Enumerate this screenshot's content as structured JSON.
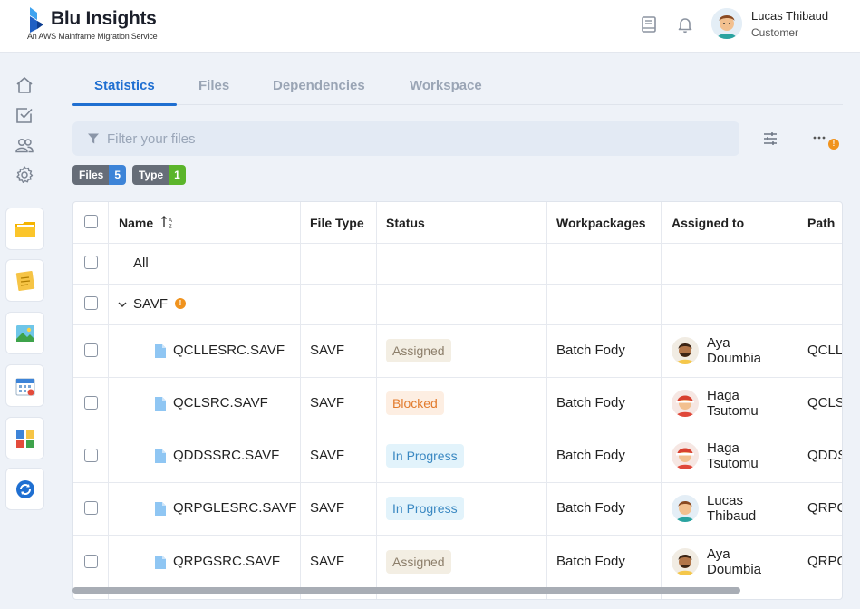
{
  "brand": {
    "title": "Blu Insights",
    "subtitle": "An AWS Mainframe Migration Service",
    "color": "#1f6fd1"
  },
  "header": {
    "icons": [
      "book-icon",
      "bell-icon"
    ],
    "user": {
      "name": "Lucas Thibaud",
      "role": "Customer"
    }
  },
  "rail": {
    "nav_icons": [
      "home-icon",
      "checklist-icon",
      "users-icon",
      "gear-icon"
    ],
    "apps": [
      "folder-app-icon",
      "notes-app-icon",
      "image-app-icon",
      "calendar-app-icon",
      "dashboard-app-icon",
      "sync-app-icon"
    ]
  },
  "tabs": [
    {
      "label": "Statistics",
      "active": true
    },
    {
      "label": "Files",
      "active": false
    },
    {
      "label": "Dependencies",
      "active": false
    },
    {
      "label": "Workspace",
      "active": false
    }
  ],
  "filter": {
    "placeholder": "Filter your files",
    "value": "",
    "alert_badge": "!"
  },
  "chips": [
    {
      "label": "Files",
      "count": "5",
      "color": "#3d84d8"
    },
    {
      "label": "Type",
      "count": "1",
      "color": "#5bb52b"
    }
  ],
  "table": {
    "columns": [
      "Name",
      "File Type",
      "Status",
      "Workpackages",
      "Assigned to",
      "Path"
    ],
    "all_label": "All",
    "group": {
      "label": "SAVF",
      "badge": "!"
    },
    "rows": [
      {
        "name": "QCLLESRC.SAVF",
        "type": "SAVF",
        "status": "Assigned",
        "status_kind": "assigned",
        "workpackage": "Batch Fody",
        "assignee_first": "Aya",
        "assignee_last": "Doumbia",
        "path": "QCLL"
      },
      {
        "name": "QCLSRC.SAVF",
        "type": "SAVF",
        "status": "Blocked",
        "status_kind": "blocked",
        "workpackage": "Batch Fody",
        "assignee_first": "Haga",
        "assignee_last": "Tsutomu",
        "path": "QCLS"
      },
      {
        "name": "QDDSSRC.SAVF",
        "type": "SAVF",
        "status": "In Progress",
        "status_kind": "progress",
        "workpackage": "Batch Fody",
        "assignee_first": "Haga",
        "assignee_last": "Tsutomu",
        "path": "QDDS"
      },
      {
        "name": "QRPGLESRC.SAVF",
        "type": "SAVF",
        "status": "In Progress",
        "status_kind": "progress",
        "workpackage": "Batch Fody",
        "assignee_first": "Lucas",
        "assignee_last": "Thibaud",
        "path": "QRPG"
      },
      {
        "name": "QRPGSRC.SAVF",
        "type": "SAVF",
        "status": "Assigned",
        "status_kind": "assigned",
        "workpackage": "Batch Fody",
        "assignee_first": "Aya",
        "assignee_last": "Doumbia",
        "path": "QRPG"
      }
    ]
  }
}
